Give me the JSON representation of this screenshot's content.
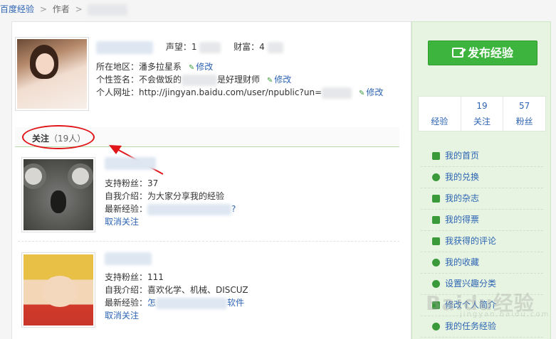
{
  "breadcrumb": {
    "home": "百度经验",
    "sep1": ">",
    "author": "作者",
    "sep2": ">"
  },
  "profile": {
    "reputation_label": "声望：",
    "reputation_value": "1",
    "wealth_label": "财富：",
    "wealth_value": "4",
    "region_label": "所在地区：",
    "region_value": "潘多拉星系",
    "signature_label": "个性签名：",
    "signature_value_start": "不会做饭的",
    "signature_value_end": "是好理财师",
    "url_label": "个人网址：",
    "url_value": "http://jingyan.baidu.com/user/npublic?un=",
    "edit_label": "修改"
  },
  "following": {
    "title": "关注",
    "count": "（19人）",
    "fans_label": "支持粉丝：",
    "intro_label": "自我介绍：",
    "latest_label": "最新经验：",
    "unfollow_label": "取消关注",
    "entries": [
      {
        "fans": "37",
        "intro": "为大家分享我的经验",
        "latest_end": "?"
      },
      {
        "fans": "111",
        "intro": "喜欢化学、机械、DISCUZ",
        "latest_start": "怎",
        "latest_end": "软件"
      }
    ]
  },
  "sidebar": {
    "publish_label": "发布经验",
    "stats": [
      {
        "num": "",
        "label": "经验"
      },
      {
        "num": "19",
        "label": "关注"
      },
      {
        "num": "57",
        "label": "粉丝"
      }
    ],
    "menu": [
      {
        "label": "我的首页",
        "icon": "home-icon"
      },
      {
        "label": "我的兑换",
        "icon": "exchange-icon"
      },
      {
        "label": "我的杂志",
        "icon": "magazine-icon"
      },
      {
        "label": "我的得票",
        "icon": "votes-icon"
      },
      {
        "label": "我获得的评论",
        "icon": "comment-icon"
      },
      {
        "label": "我的收藏",
        "icon": "star-icon"
      },
      {
        "label": "设置兴趣分类",
        "icon": "gear-icon"
      },
      {
        "label": "修改个人简介",
        "icon": "user-icon"
      },
      {
        "label": "我的任务经验",
        "icon": "task-icon"
      }
    ]
  },
  "watermark": {
    "text": "Baidu经验",
    "sub": "jingyan.baidu.com"
  },
  "colors": {
    "accent_green": "#3db43d",
    "link_blue": "#2d64b3",
    "annotation_red": "#e0161a"
  }
}
